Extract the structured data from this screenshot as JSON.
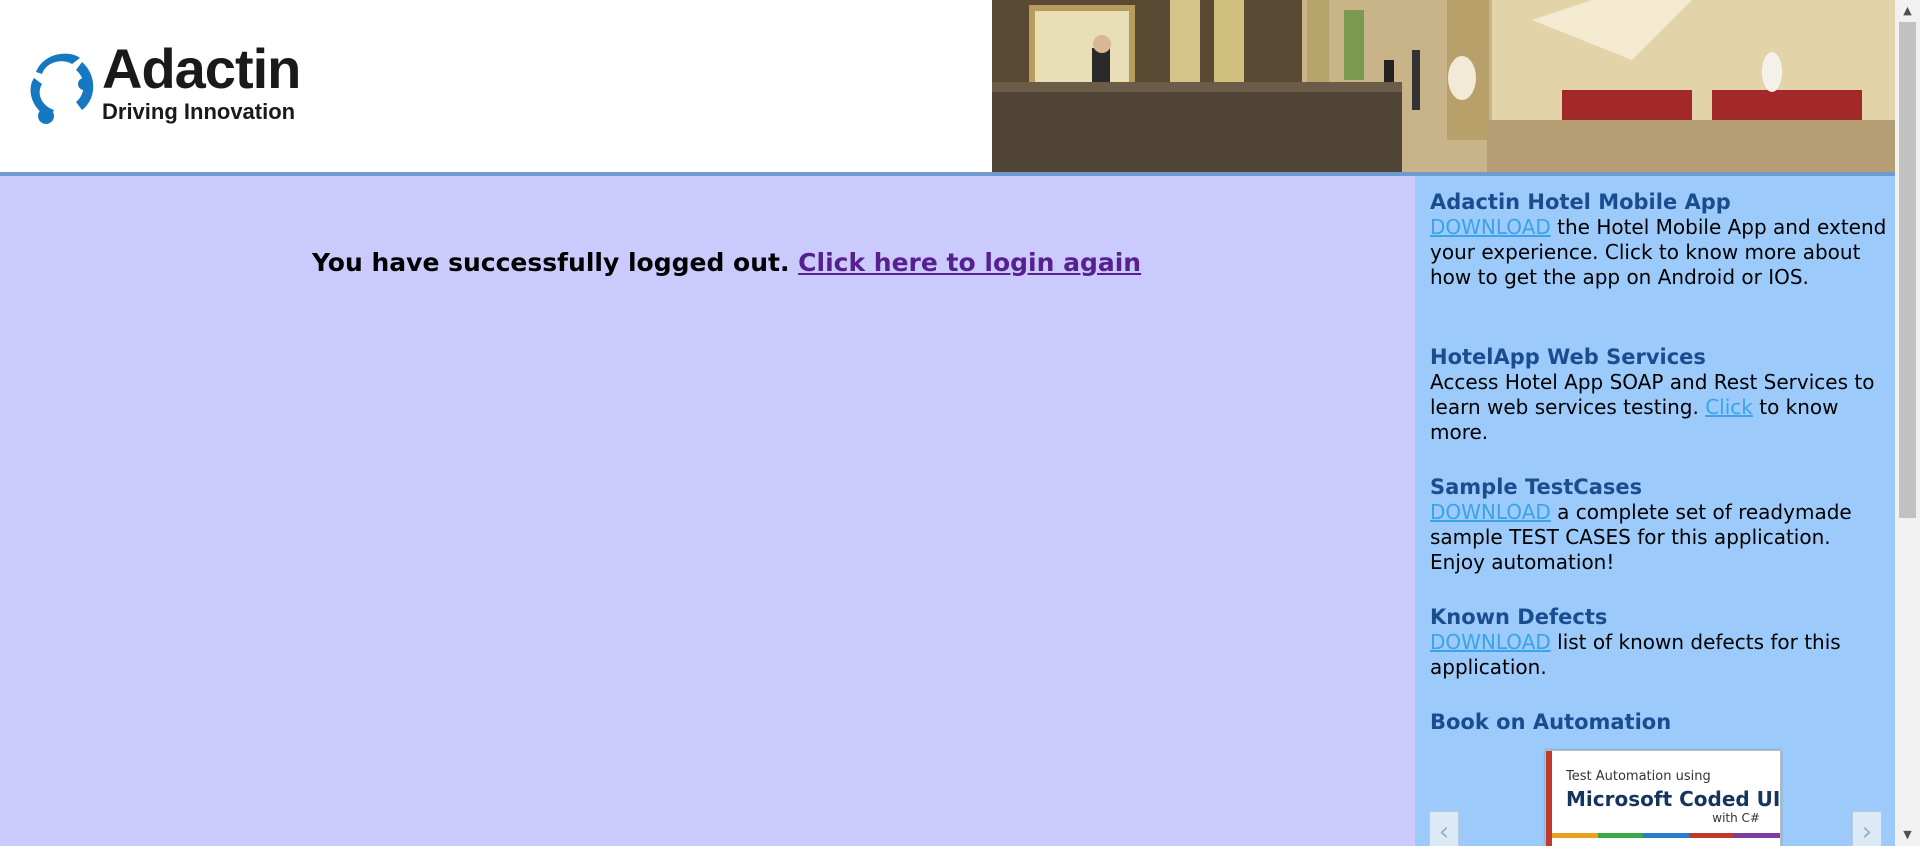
{
  "header": {
    "logo_title": "Adactin",
    "logo_tagline": "Driving Innovation"
  },
  "main": {
    "logout_message": "You have successfully logged out. ",
    "login_again_link": "Click here to login again"
  },
  "sidebar": {
    "mobile_app": {
      "title": "Adactin Hotel Mobile App",
      "link": "DOWNLOAD",
      "text": " the Hotel Mobile App and extend your experience. Click to know more about how to get the app on Android or IOS."
    },
    "web_services": {
      "title": "HotelApp Web Services",
      "text_before": "Access Hotel App SOAP and Rest Services to learn web services testing. ",
      "link": "Click",
      "text_after": " to know more."
    },
    "test_cases": {
      "title": "Sample TestCases",
      "link": "DOWNLOAD",
      "text": " a complete set of readymade sample TEST CASES for this application. Enjoy automation!"
    },
    "known_defects": {
      "title": "Known Defects",
      "link": "DOWNLOAD",
      "text": " list of known defects for this application."
    },
    "book": {
      "title": "Book on Automation",
      "cover_subtitle": "Test Automation using",
      "cover_title": "Microsoft Coded UI",
      "cover_with": "with C#"
    }
  },
  "colors": {
    "main_bg": "#cacafc",
    "sidebar_bg": "#9ccbfb",
    "header_border": "#6e9ad0",
    "sidebar_title": "#1a4d8f",
    "sidebar_link": "#3aa3ea",
    "visited_link": "#56208f"
  },
  "icons": {
    "logo": "adactin-logo-icon",
    "carousel_prev": "chevron-left-icon",
    "carousel_next": "chevron-right-icon"
  }
}
